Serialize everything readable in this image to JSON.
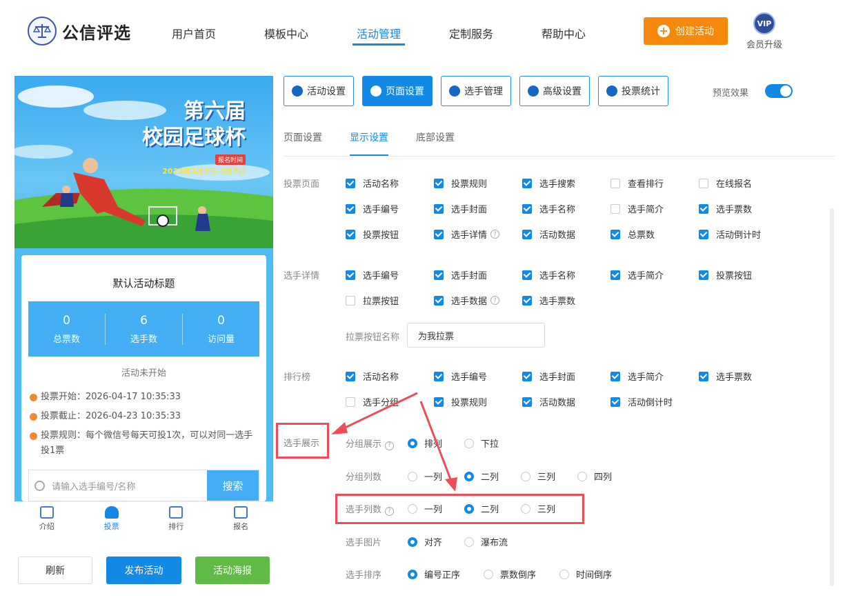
{
  "header": {
    "logo_text": "公信评选",
    "nav": [
      "用户首页",
      "模板中心",
      "活动管理",
      "定制服务",
      "帮助中心"
    ],
    "active_nav": "活动管理",
    "create_label": "创建活动",
    "vip_badge": "VIP",
    "vip_label": "会员升级"
  },
  "preview": {
    "banner": {
      "line1": "第六届",
      "line2": "校园足球杯",
      "tag": "报名时间",
      "date": "2023年3月2日-3月7日"
    },
    "card_title": "默认活动标题",
    "stats": [
      {
        "value": "0",
        "label": "总票数"
      },
      {
        "value": "6",
        "label": "选手数"
      },
      {
        "value": "0",
        "label": "访问量"
      }
    ],
    "status": "活动未开始",
    "info": [
      "投票开始：2026-04-17 10:35:33",
      "投票截止：2026-04-23 10:35:33",
      "投票规则：每个微信号每天可投1次，可以对同一选手投1票"
    ],
    "search_placeholder": "请输入选手编号/名称",
    "search_button": "搜索",
    "tabbar": [
      "介绍",
      "投票",
      "排行",
      "报名"
    ],
    "tabbar_active": "投票"
  },
  "buttons": {
    "refresh": "刷新",
    "publish": "发布活动",
    "poster": "活动海报"
  },
  "tabs": [
    "活动设置",
    "页面设置",
    "选手管理",
    "高级设置",
    "投票统计"
  ],
  "active_tab": "页面设置",
  "preview_toggle": {
    "label": "预览效果",
    "on": true
  },
  "subtabs": [
    "页面设置",
    "显示设置",
    "底部设置"
  ],
  "active_subtab": "显示设置",
  "sections": {
    "vote_page": {
      "label": "投票页面",
      "items": [
        {
          "t": "活动名称",
          "c": true
        },
        {
          "t": "投票规则",
          "c": true
        },
        {
          "t": "选手搜索",
          "c": true
        },
        {
          "t": "查看排行",
          "c": false
        },
        {
          "t": "在线报名",
          "c": false
        },
        {
          "t": "选手编号",
          "c": true
        },
        {
          "t": "选手封面",
          "c": true
        },
        {
          "t": "选手名称",
          "c": true
        },
        {
          "t": "选手简介",
          "c": false
        },
        {
          "t": "选手票数",
          "c": true
        },
        {
          "t": "投票按钮",
          "c": true
        },
        {
          "t": "选手详情",
          "c": true
        },
        {
          "t": "活动数据",
          "c": true
        },
        {
          "t": "总票数",
          "c": true
        },
        {
          "t": "活动倒计时",
          "c": true
        }
      ]
    },
    "detail": {
      "label": "选手详情",
      "items": [
        {
          "t": "选手编号",
          "c": true
        },
        {
          "t": "选手封面",
          "c": true
        },
        {
          "t": "选手名称",
          "c": true
        },
        {
          "t": "选手简介",
          "c": true
        },
        {
          "t": "投票按钮",
          "c": true
        },
        {
          "t": "拉票按钮",
          "c": false
        },
        {
          "t": "选手数据",
          "c": true
        },
        {
          "t": "选手票数",
          "c": true
        }
      ],
      "canvass_label": "拉票按钮名称",
      "canvass_value": "为我拉票"
    },
    "ranking": {
      "label": "排行榜",
      "items": [
        {
          "t": "活动名称",
          "c": true
        },
        {
          "t": "选手编号",
          "c": true
        },
        {
          "t": "选手封面",
          "c": true
        },
        {
          "t": "选手简介",
          "c": true
        },
        {
          "t": "选手票数",
          "c": true
        },
        {
          "t": "选手分组",
          "c": false
        },
        {
          "t": "投票规则",
          "c": true
        },
        {
          "t": "活动数据",
          "c": true
        },
        {
          "t": "活动倒计时",
          "c": true
        }
      ]
    },
    "display": {
      "label": "选手展示",
      "rows": [
        {
          "label": "分组展示",
          "help": true,
          "options": [
            "排列",
            "下拉"
          ],
          "selected": "排列"
        },
        {
          "label": "分组列数",
          "help": false,
          "options": [
            "一列",
            "二列",
            "三列",
            "四列"
          ],
          "selected": "二列"
        },
        {
          "label": "选手列数",
          "help": true,
          "options": [
            "一列",
            "二列",
            "三列"
          ],
          "selected": "二列"
        },
        {
          "label": "选手图片",
          "help": false,
          "options": [
            "对齐",
            "瀑布流"
          ],
          "selected": "对齐"
        },
        {
          "label": "选手排序",
          "help": false,
          "options": [
            "编号正序",
            "票数倒序",
            "时间倒序"
          ],
          "selected": "编号正序"
        }
      ]
    }
  },
  "colors": {
    "primary": "#1389e6",
    "orange": "#f5890d",
    "green": "#5fbb46",
    "highlight": "#ee4d57"
  }
}
